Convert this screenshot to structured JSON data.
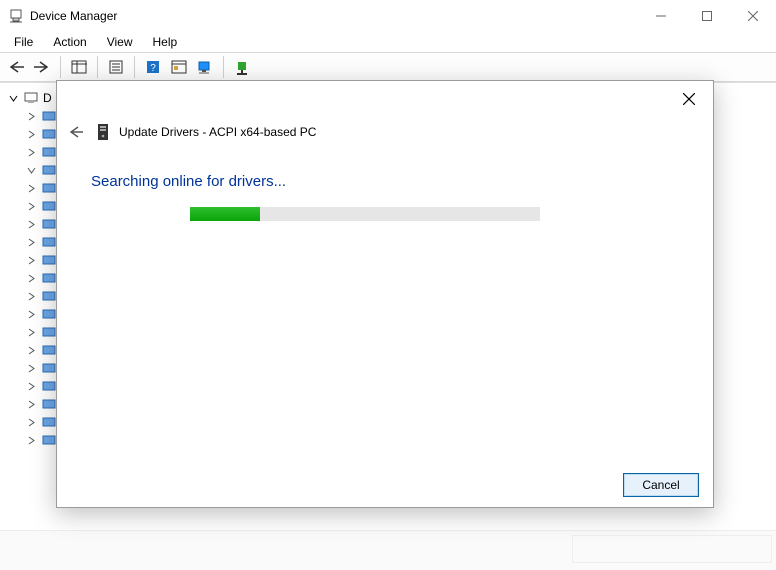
{
  "window": {
    "title": "Device Manager"
  },
  "menu": {
    "file": "File",
    "action": "Action",
    "view": "View",
    "help": "Help"
  },
  "tree": {
    "root_label": "D",
    "visible_child_count": 4,
    "visible_collapsed_rows": 15
  },
  "dialog": {
    "title_prefix": "Update Drivers - ",
    "device_name": "ACPI x64-based PC",
    "heading": "Searching online for drivers...",
    "progress_percent": 20,
    "cancel_label": "Cancel"
  }
}
